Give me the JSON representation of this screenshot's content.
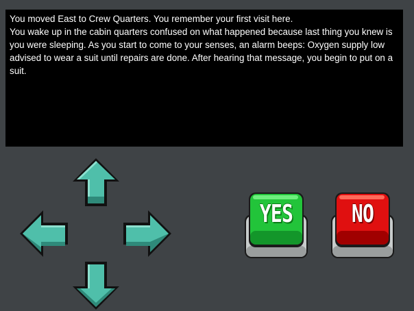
{
  "log": {
    "lines": [
      "You moved East to Crew Quarters. You remember your first visit here.",
      "You wake up in the cabin quarters confused on what happened because last thing you knew is you were sleeping. As you start to come to your senses, an alarm beeps: Oxygen supply low advised to wear a suit until repairs are done. After hearing that message, you begin to put on a suit."
    ]
  },
  "controls": {
    "arrows": [
      {
        "direction": "up",
        "icon": "arrow-up-icon"
      },
      {
        "direction": "left",
        "icon": "arrow-left-icon"
      },
      {
        "direction": "right",
        "icon": "arrow-right-icon"
      },
      {
        "direction": "down",
        "icon": "arrow-down-icon"
      }
    ],
    "yes_label": "YES",
    "no_label": "NO"
  },
  "colors": {
    "background": "#3f4346",
    "log_background": "#000000",
    "log_text": "#ffffff",
    "arrow_fill": "#4fbfaa",
    "arrow_shade": "#2f8a7a",
    "arrow_outline": "#111111",
    "yes_button": "#22c43a",
    "no_button": "#e01010",
    "button_base": "#c8cccc"
  }
}
